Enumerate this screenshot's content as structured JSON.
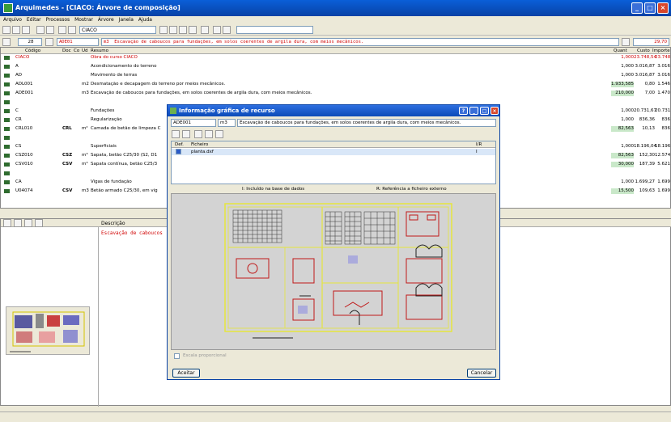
{
  "window": {
    "title": "Arquimedes - [CIACO: Árvore de composição]"
  },
  "menu": [
    "Arquivo",
    "Editar",
    "Processos",
    "Mostrar",
    "Árvore",
    "Janela",
    "Ajuda"
  ],
  "toolbar": {
    "project_combo": "CIACO",
    "search_combo": ""
  },
  "record_bar": {
    "number": "28",
    "code": "ADE01",
    "unit": "m3",
    "summary": "Escavação de caboucos para fundações, em solos coerentes de argila dura, com meios mecânicos.",
    "total": "29,70"
  },
  "grid": {
    "headers": {
      "code": "Código",
      "doc": "Doc",
      "co": "Co",
      "ud": "Ud",
      "summary": "Resumo",
      "qty": "Quant",
      "price": "Custo",
      "amount": "Importe"
    },
    "rows": [
      {
        "code": "CIACO",
        "doc": "",
        "co": "",
        "ud": "",
        "summary": "Obra do curso CIACO",
        "qty": "1,000",
        "price": "23.748,54",
        "amount": "23.748",
        "red": true
      },
      {
        "code": "A",
        "doc": "",
        "co": "",
        "ud": "",
        "summary": "Acondicionamento do terreno",
        "qty": "1,000",
        "price": "3.016,87",
        "amount": "3.016"
      },
      {
        "code": "AD",
        "doc": "",
        "co": "",
        "ud": "",
        "summary": "Movimento de terras",
        "qty": "1,000",
        "price": "3.016,87",
        "amount": "3.016"
      },
      {
        "code": "ADL001",
        "doc": "",
        "co": "",
        "ud": "m2",
        "summary": "Desmatação e decapagem do terreno por meios mecânicos.",
        "qty": "1.933,585",
        "price": "0,80",
        "amount": "1.546"
      },
      {
        "code": "ADE001",
        "doc": "",
        "co": "",
        "ud": "m3",
        "summary": "Escavação de caboucos para fundações, em solos coerentes de argila dura, com meios mecânicos.",
        "qty": "210,000",
        "price": "7,00",
        "amount": "1.470"
      },
      {
        "code": "",
        "doc": "",
        "co": "",
        "ud": "",
        "summary": "",
        "qty": "",
        "price": "",
        "amount": ""
      },
      {
        "code": "C",
        "doc": "",
        "co": "",
        "ud": "",
        "summary": "Fundações",
        "qty": "1,000",
        "price": "20.731,67",
        "amount": "20.731"
      },
      {
        "code": "CR",
        "doc": "",
        "co": "",
        "ud": "",
        "summary": "Regularização",
        "qty": "1,000",
        "price": "836,36",
        "amount": "836"
      },
      {
        "code": "CRL010",
        "doc": "CRL",
        "co": "",
        "ud": "m²",
        "summary": "Camada de betão de limpeza C",
        "qty": "82,563",
        "price": "10,13",
        "amount": "836"
      },
      {
        "code": "",
        "doc": "",
        "co": "",
        "ud": "",
        "summary": "",
        "qty": "",
        "price": "",
        "amount": ""
      },
      {
        "code": "CS",
        "doc": "",
        "co": "",
        "ud": "",
        "summary": "Superficiais",
        "qty": "1,000",
        "price": "18.196,04",
        "amount": "18.196"
      },
      {
        "code": "CSZ010",
        "doc": "CSZ",
        "co": "",
        "ud": "m³",
        "summary": "Sapata, betão C25/30 (S2, D1",
        "qty": "82,563",
        "price": "152,30",
        "amount": "12.574"
      },
      {
        "code": "CSV010",
        "doc": "CSV",
        "co": "",
        "ud": "m³",
        "summary": "Sapata contínua, betão C25/3",
        "qty": "30,000",
        "price": "187,39",
        "amount": "5.621"
      },
      {
        "code": "",
        "doc": "",
        "co": "",
        "ud": "",
        "summary": "",
        "qty": "",
        "price": "",
        "amount": ""
      },
      {
        "code": "CA",
        "doc": "",
        "co": "",
        "ud": "",
        "summary": "Vigas de fundação",
        "qty": "1,000",
        "price": "1.699,27",
        "amount": "1.699"
      },
      {
        "code": "U04074",
        "doc": "CSV",
        "co": "",
        "ud": "m3",
        "summary": "Betão armado C25/30, em vig",
        "qty": "15,500",
        "price": "109,63",
        "amount": "1.699"
      }
    ]
  },
  "lower_panel": {
    "header": "Descrição",
    "text": "Escavação de caboucos"
  },
  "dialog": {
    "title": "Informação gráfica de recurso",
    "code": "ADE001",
    "unit": "m3",
    "summary": "Escavação de caboucos para fundações, em solos coerentes de argila dura, com meios mecânicos.",
    "list_headers": {
      "def": "Def.",
      "file": "Ficheiro",
      "ir": "I/R"
    },
    "files": [
      {
        "file": "planta.dxf",
        "ir": "I"
      }
    ],
    "legend_included": "I: Incluído na base de dados",
    "legend_reference": "R: Referência a ficheiro externo",
    "proportional_label": "Escala proporcional",
    "accept": "Aceitar",
    "cancel": "Cancelar"
  },
  "colors": {
    "title_blue": "#0a4ab8",
    "code_red": "#d00000",
    "cad_yellow": "#e6e63c",
    "highlight_green": "#c9e8c9"
  }
}
